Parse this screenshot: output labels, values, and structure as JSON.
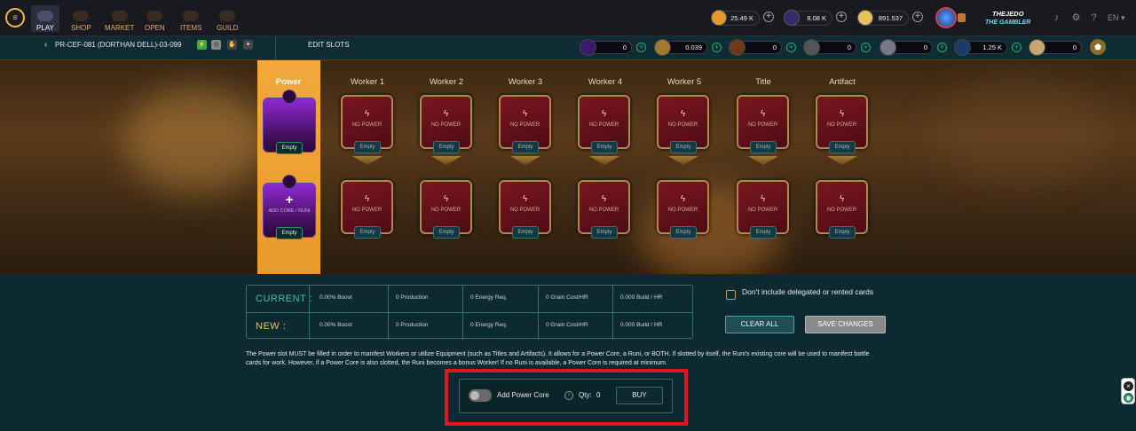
{
  "nav": {
    "items": [
      {
        "label": "PLAY",
        "active": true
      },
      {
        "label": "SHOP"
      },
      {
        "label": "MARKET"
      },
      {
        "label": "OPEN"
      },
      {
        "label": "ITEMS"
      },
      {
        "label": "GUILD"
      }
    ],
    "resources": [
      {
        "icon": "coin-icon",
        "value": "25.49 K"
      },
      {
        "icon": "voucher-icon",
        "value": "8.08 K"
      },
      {
        "icon": "ticket-icon",
        "value": "891.537"
      }
    ],
    "user": {
      "name": "THEJEDO",
      "title": "THE GAMBLER"
    },
    "language": "EN"
  },
  "subbar": {
    "back_icon": "chevron-left-icon",
    "land_name": "PR-CEF-081 (DORTHAN DELL)-03-099",
    "edit_slots": "EDIT SLOTS",
    "resources": [
      {
        "icon": "power-orb-icon",
        "value": "0"
      },
      {
        "icon": "grain-icon",
        "value": "0.039"
      },
      {
        "icon": "wood-icon",
        "value": "0"
      },
      {
        "icon": "stone-icon",
        "value": "0"
      },
      {
        "icon": "iron-icon",
        "value": "0"
      },
      {
        "icon": "crystal-icon",
        "value": "1.25 K"
      },
      {
        "icon": "scroll-icon",
        "value": "0"
      }
    ]
  },
  "slots": {
    "columns": [
      "Power",
      "Worker 1",
      "Worker 2",
      "Worker 3",
      "Worker 4",
      "Worker 5",
      "Title",
      "Artifact"
    ],
    "no_power": "NO POWER",
    "empty": "Empty",
    "add_core": "ADD CORE / RUNI",
    "add_plus": "+"
  },
  "stats": {
    "current_label": "CURRENT :",
    "new_label": "NEW :",
    "current": [
      "0.00% Boost",
      "0 Production",
      "0 Energy Req.",
      "0 Grain Cost/HR",
      "0.000 Build / HR"
    ],
    "new": [
      "0.00% Boost",
      "0 Production",
      "0 Energy Req.",
      "0 Grain Cost/HR",
      "0.000 Build / HR"
    ]
  },
  "options": {
    "exclude_label": "Don't include delegated or rented cards",
    "clear_all": "CLEAR ALL",
    "save_changes": "SAVE CHANGES"
  },
  "info_text": "The Power slot MUST be filled in order to manifest Workers or utilize Equipment (such as Titles and Artifacts). It allows for a Power Core, a Runi, or BOTH. If slotted by itself, the Runi's existing core will be used to manifest battle cards for work. However, if a Power Core is also slotted, the Runi becomes a bonus Worker! If no Runi is available, a Power Core is required at minimum.",
  "power_core": {
    "toggle_label": "Add Power Core",
    "qty_label": "Qty:",
    "qty_value": "0",
    "buy": "BUY",
    "toggled": false
  },
  "colors": {
    "accent": "#e89a2a",
    "highlight": "#e0151d",
    "teal": "#3a6f67"
  }
}
